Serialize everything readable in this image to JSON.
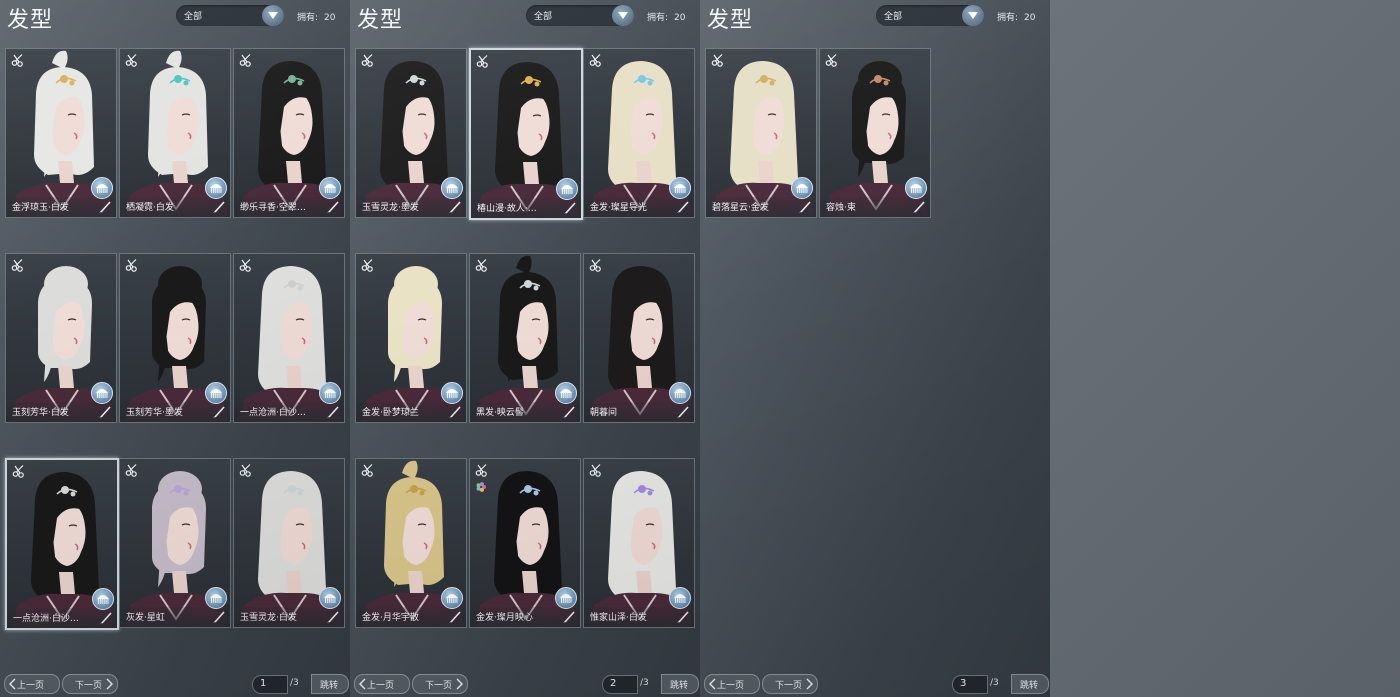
{
  "panels": [
    {
      "title": "发型",
      "filter": "全部",
      "owned_label": "拥有:",
      "owned_count": "20",
      "page_current": "1",
      "page_total": "/3",
      "prev_label": "上一页",
      "next_label": "下一页",
      "jump_label": "跳转",
      "cards": [
        {
          "name": "金浮琼玉·白发",
          "hair": "#e6e6e4",
          "style": "ponytail",
          "ornament": "#d9b15a",
          "selected": false
        },
        {
          "name": "栖凝霓·白发",
          "hair": "#e3e3e1",
          "style": "ponytail",
          "ornament": "#4cc6c0",
          "selected": false
        },
        {
          "name": "缈乐寻香·空翠…",
          "hair": "#1c1b1c",
          "style": "long",
          "ornament": "#77b59a",
          "selected": false
        },
        {
          "name": "玉刻芳华·白发",
          "hair": "#dcdcda",
          "style": "bun",
          "ornament": "",
          "selected": false
        },
        {
          "name": "玉刻芳华·墨发",
          "hair": "#1b1a1b",
          "style": "bun",
          "ornament": "",
          "selected": false
        },
        {
          "name": "一点沧洲·白沙…",
          "hair": "#e0e0de",
          "style": "long",
          "ornament": "#cfcfcf",
          "selected": false
        },
        {
          "name": "一点沧洲·白沙…",
          "hair": "#1a191a",
          "style": "long",
          "ornament": "#d8d8d8",
          "selected": true
        },
        {
          "name": "灰发·星虹",
          "hair": "#c6bccb",
          "style": "bun",
          "ornament": "#b9a6d6",
          "selected": false
        },
        {
          "name": "玉雪灵龙·白发",
          "hair": "#dededc",
          "style": "long",
          "ornament": "#cfd6d8",
          "selected": false
        }
      ]
    },
    {
      "title": "发型",
      "filter": "全部",
      "owned_label": "拥有:",
      "owned_count": "20",
      "page_current": "2",
      "page_total": "/3",
      "prev_label": "上一页",
      "next_label": "下一页",
      "jump_label": "跳转",
      "cards": [
        {
          "name": "玉雪灵龙·墨发",
          "hair": "#1c1b1c",
          "style": "long",
          "ornament": "#cfd6d8",
          "selected": false
        },
        {
          "name": "椿山漫·故人·…",
          "hair": "#1b1a1a",
          "style": "long",
          "ornament": "#e0b04a",
          "selected": true
        },
        {
          "name": "金发·璨星导光",
          "hair": "#e7e0c6",
          "style": "long",
          "ornament": "#7ac7e8",
          "selected": false
        },
        {
          "name": "金发·卧梦琼兰",
          "hair": "#e9e2c4",
          "style": "bun",
          "ornament": "",
          "selected": false
        },
        {
          "name": "黑发·映云髻",
          "hair": "#1a191a",
          "style": "ponytail",
          "ornament": "#cfd6d8",
          "selected": false
        },
        {
          "name": "朝暮间",
          "hair": "#1d1b1b",
          "style": "long",
          "ornament": "",
          "selected": false
        },
        {
          "name": "金发·月华宇散",
          "hair": "#d8c58a",
          "style": "ponytail",
          "ornament": "#c8a24a",
          "selected": false
        },
        {
          "name": "金发·璨月映心",
          "hair": "#141416",
          "style": "long",
          "ornament": "#a7c8e6",
          "selected": false
        },
        {
          "name": "惟家山泽·白发",
          "hair": "#e8e8e6",
          "style": "long",
          "ornament": "#a689e0",
          "selected": false
        }
      ]
    },
    {
      "title": "发型",
      "filter": "全部",
      "owned_label": "拥有:",
      "owned_count": "20",
      "page_current": "3",
      "page_total": "/3",
      "prev_label": "上一页",
      "next_label": "下一页",
      "jump_label": "跳转",
      "cards": [
        {
          "name": "碧落星云·金发",
          "hair": "#e6dfc6",
          "style": "long",
          "ornament": "#d0b060",
          "selected": false
        },
        {
          "name": "容烛·束",
          "hair": "#1a1919",
          "style": "bun",
          "ornament": "#c08a6a",
          "selected": false
        }
      ]
    }
  ]
}
